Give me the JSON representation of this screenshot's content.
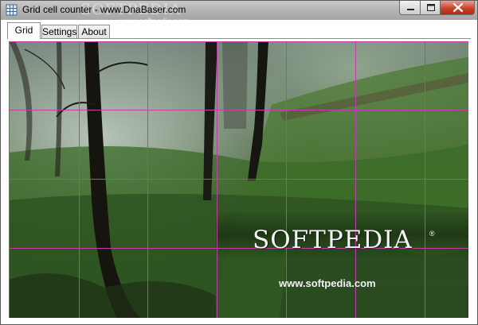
{
  "window": {
    "title": "Grid cell counter - www.DnaBaser.com",
    "watermark": "SOFTPEDIA",
    "watermark_url": "www.softpedia.com"
  },
  "tabs": [
    {
      "label": "Grid",
      "active": true
    },
    {
      "label": "Settings",
      "active": false
    },
    {
      "label": "About",
      "active": false
    }
  ],
  "image": {
    "watermark_logo": "SOFTPEDIA",
    "watermark_reg": "®",
    "watermark_url": "www.softpedia.com"
  },
  "grid": {
    "line_color": "#c33fa8",
    "columns": 7,
    "rows": 4
  },
  "icons": {
    "app": "app-icon",
    "minimize": "minimize-icon",
    "maximize": "maximize-icon",
    "close": "close-icon"
  }
}
